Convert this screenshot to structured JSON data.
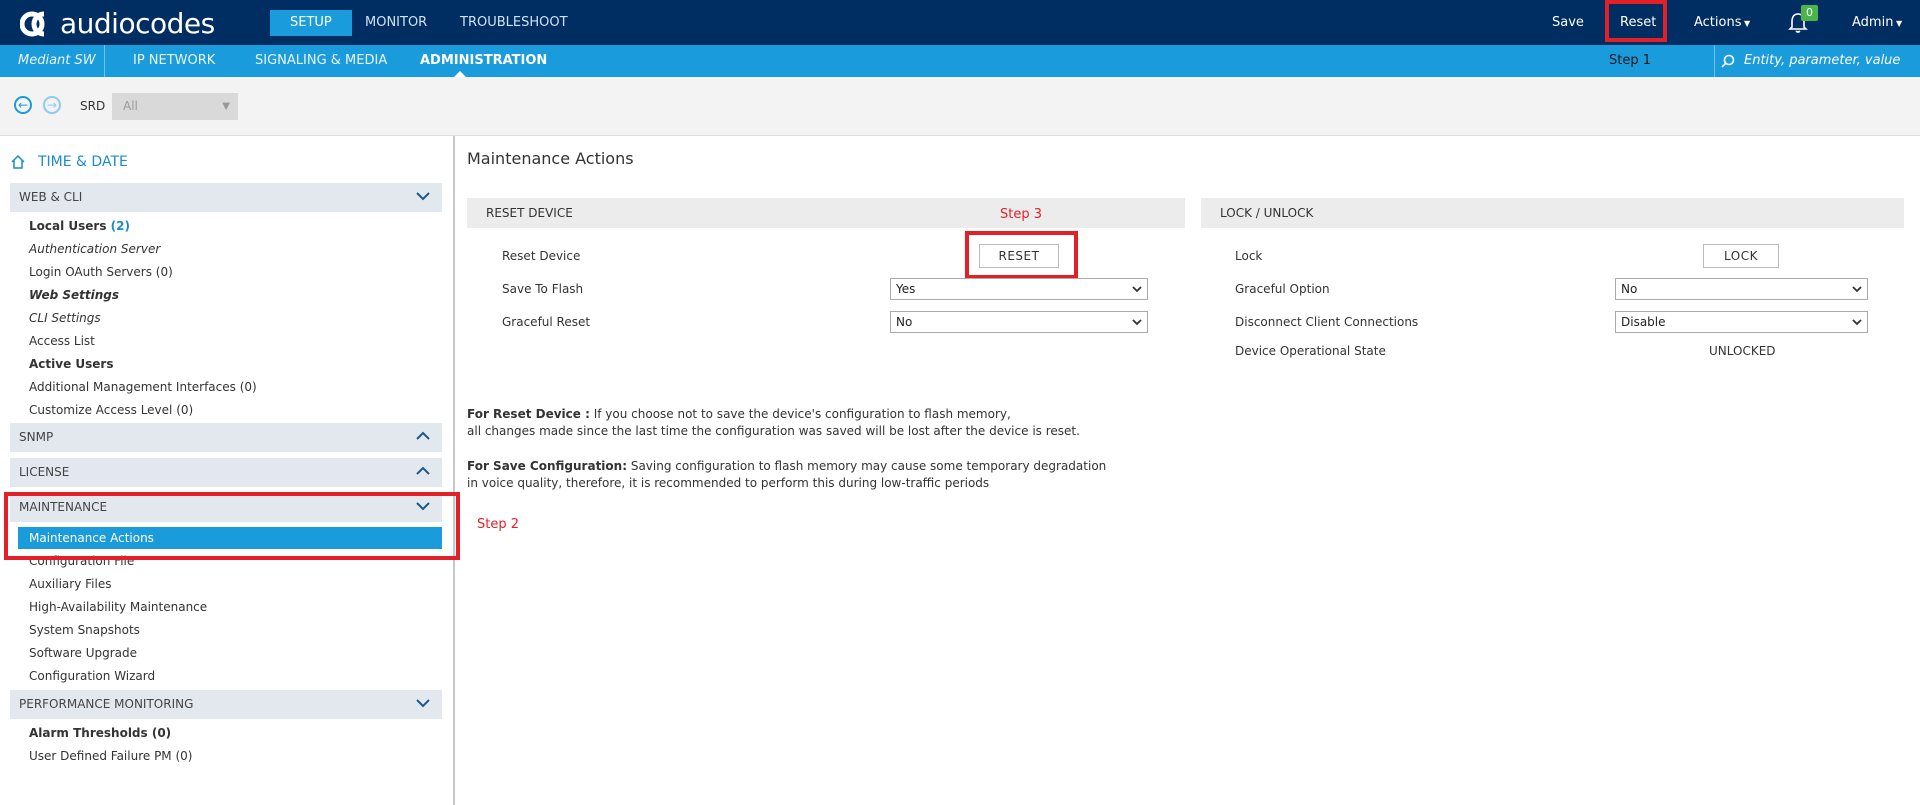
{
  "brand": {
    "logo_text": "audiocodes"
  },
  "top_nav": {
    "tabs": [
      "SETUP",
      "MONITOR",
      "TROUBLESHOOT"
    ]
  },
  "top_right": {
    "save": "Save",
    "reset": "Reset",
    "actions": "Actions",
    "notifications_count": "0",
    "admin": "Admin"
  },
  "sub_nav": {
    "device": "Mediant SW",
    "tabs": [
      "IP NETWORK",
      "SIGNALING & MEDIA",
      "ADMINISTRATION"
    ],
    "search_placeholder": "Entity, parameter, value"
  },
  "srd": {
    "label": "SRD",
    "value": "All"
  },
  "sidebar": {
    "home": "TIME & DATE",
    "sections": {
      "web_cli": "WEB & CLI",
      "snmp": "SNMP",
      "license": "LICENSE",
      "maintenance": "MAINTENANCE",
      "performance": "PERFORMANCE MONITORING"
    },
    "web_cli_items": {
      "local_users": "Local Users",
      "local_users_count": "(2)",
      "auth_server": "Authentication Server",
      "login_oauth": "Login OAuth Servers (0)",
      "web_settings": "Web Settings",
      "cli_settings": "CLI Settings",
      "access_list": "Access List",
      "active_users": "Active Users",
      "additional_mgmt": "Additional Management Interfaces (0)",
      "customize_access": "Customize Access Level (0)"
    },
    "maintenance_items": {
      "maintenance_actions": "Maintenance Actions",
      "configuration_file": "Configuration File",
      "auxiliary_files": "Auxiliary Files",
      "ha_maintenance": "High-Availability Maintenance",
      "system_snapshots": "System Snapshots",
      "software_upgrade": "Software Upgrade",
      "configuration_wizard": "Configuration Wizard"
    },
    "performance_items": {
      "alarm_thresholds": "Alarm Thresholds (0)",
      "user_defined_pm": "User Defined Failure PM (0)"
    }
  },
  "main": {
    "title": "Maintenance Actions",
    "reset_panel": {
      "header": "RESET DEVICE",
      "reset_device_label": "Reset Device",
      "reset_button": "RESET",
      "save_to_flash_label": "Save To Flash",
      "save_to_flash_value": "Yes",
      "graceful_reset_label": "Graceful Reset",
      "graceful_reset_value": "No"
    },
    "lock_panel": {
      "header": "LOCK / UNLOCK",
      "lock_label": "Lock",
      "lock_button": "LOCK",
      "graceful_option_label": "Graceful Option",
      "graceful_option_value": "No",
      "disconnect_label": "Disconnect Client Connections",
      "disconnect_value": "Disable",
      "op_state_label": "Device Operational State",
      "op_state_value": "UNLOCKED"
    },
    "notes": {
      "reset_bold": "For Reset Device :",
      "reset_text1": " If you choose not to save the device's configuration to flash memory,",
      "reset_text2": "all changes made since the last time the configuration was saved will be lost after the device is reset.",
      "save_bold": "For Save Configuration:",
      "save_text1": " Saving configuration to flash memory may cause some temporary degradation",
      "save_text2": "in voice quality, therefore, it is recommended to perform this during low-traffic periods"
    }
  },
  "annotations": {
    "step1": "Step 1",
    "step2": "Step 2",
    "step3": "Step 3"
  },
  "colors": {
    "topbar": "#002d62",
    "accent": "#1a9cdc",
    "highlight": "#e32028",
    "badge": "#48b648"
  }
}
